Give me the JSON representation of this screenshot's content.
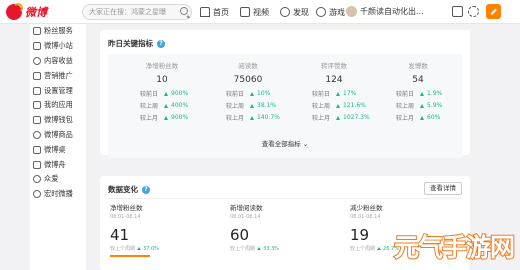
{
  "brand": {
    "name": "微博"
  },
  "search": {
    "placeholder": "大家正在搜：鸿蒙之星曝"
  },
  "nav": {
    "home": "首页",
    "video": "视频",
    "discover": "发现",
    "game": "游戏",
    "user": "千颜读自动化出..."
  },
  "sidebar": {
    "items": [
      {
        "label": "粉丝服务",
        "icon": "fans-icon"
      },
      {
        "label": "微博小站",
        "icon": "site-icon"
      },
      {
        "label": "内容收益",
        "icon": "income-icon"
      },
      {
        "label": "营销推广",
        "icon": "promotion-icon"
      },
      {
        "label": "设置管理",
        "icon": "settings-icon"
      },
      {
        "label": "我的应用",
        "icon": "apps-icon"
      },
      {
        "label": "微博钱包",
        "icon": "wallet-icon"
      },
      {
        "label": "微博商品",
        "icon": "goods-icon"
      },
      {
        "label": "微博桌",
        "icon": "desk-icon"
      },
      {
        "label": "微博舟",
        "icon": "boat-icon"
      },
      {
        "label": "众爱",
        "icon": "love-icon"
      },
      {
        "label": "宏时微播",
        "icon": "live-icon"
      }
    ]
  },
  "panel1": {
    "title": "昨日关键指标",
    "expand_label": "查看全部指标 ⌄",
    "columns": [
      {
        "label": "净增粉丝数",
        "value": "10",
        "cmp": [
          {
            "k": "较前日",
            "v": "900%"
          },
          {
            "k": "较上周",
            "v": "400%"
          },
          {
            "k": "较上月",
            "v": "900%"
          }
        ]
      },
      {
        "label": "阅读数",
        "value": "75060",
        "cmp": [
          {
            "k": "较前日",
            "v": "10%"
          },
          {
            "k": "较上周",
            "v": "38.1%"
          },
          {
            "k": "较上月",
            "v": "140.7%"
          }
        ]
      },
      {
        "label": "转评赞数",
        "value": "124",
        "cmp": [
          {
            "k": "较前日",
            "v": "17%"
          },
          {
            "k": "较上周",
            "v": "121.6%"
          },
          {
            "k": "较上月",
            "v": "1027.3%"
          }
        ]
      },
      {
        "label": "发博数",
        "value": "54",
        "cmp": [
          {
            "k": "较前日",
            "v": "1.9%"
          },
          {
            "k": "较上周",
            "v": "5.9%"
          },
          {
            "k": "较上月",
            "v": "60%"
          }
        ]
      }
    ]
  },
  "panel2": {
    "title": "数据变化",
    "check_button": "查看详情",
    "kpis": [
      {
        "label": "净增粉丝数",
        "date": "08.01-08.14",
        "value": "41",
        "cmp_prefix": "较上个周期",
        "cmp_value": "37.0%"
      },
      {
        "label": "新增阅读数",
        "date": "08.01-08.14",
        "value": "60",
        "cmp_prefix": "较上个周期",
        "cmp_value": "33.3%"
      },
      {
        "label": "减少粉丝数",
        "date": "08.01-08.14",
        "value": "19",
        "cmp_prefix": "较上个周期",
        "cmp_value": "26.7%"
      }
    ]
  },
  "watermark": {
    "text": "元气手游网"
  },
  "colors": {
    "accent": "#ff8200",
    "brand_red": "#e6162d",
    "up_green": "#17b890",
    "help_blue": "#3ea1ea"
  }
}
